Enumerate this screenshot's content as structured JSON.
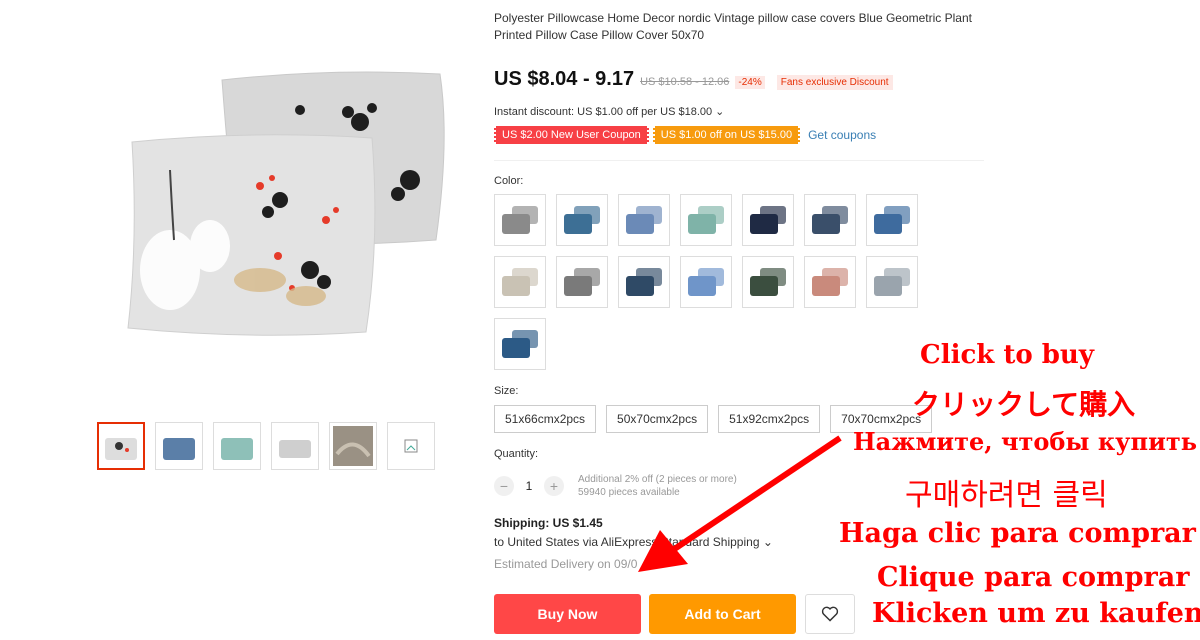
{
  "product": {
    "title": "Polyester Pillowcase Home Decor nordic Vintage pillow case covers Blue Geometric Plant Printed Pillow Case Pillow Cover 50x70",
    "price": "US $8.04 - 9.17",
    "original_price": "US $10.58 - 12.06",
    "discount_percent": "-24%",
    "fans_discount": "Fans exclusive Discount",
    "instant_discount": "Instant discount: US $1.00 off per US $18.00 ⌄",
    "coupons": [
      {
        "label": "US $2.00 New User Coupon",
        "color": "#f74045"
      },
      {
        "label": "US $1.00 off on US $15.00",
        "color": "#f79b0e"
      }
    ],
    "get_coupons": "Get coupons"
  },
  "color": {
    "label": "Color:",
    "swatches": [
      {
        "name": "color-1",
        "bg": "#ffffff",
        "fg": "#8a8a8a"
      },
      {
        "name": "color-2",
        "bg": "#ffffff",
        "fg": "#3d6f95"
      },
      {
        "name": "color-3",
        "bg": "#ffffff",
        "fg": "#6b8ab7"
      },
      {
        "name": "color-4",
        "bg": "#ffffff",
        "fg": "#7fb3a8"
      },
      {
        "name": "color-5",
        "bg": "#ffffff",
        "fg": "#1f2a44"
      },
      {
        "name": "color-6",
        "bg": "#ffffff",
        "fg": "#3a4f6a"
      },
      {
        "name": "color-7",
        "bg": "#ffffff",
        "fg": "#3e6b9e"
      },
      {
        "name": "color-8",
        "bg": "#ffffff",
        "fg": "#c9c2b4"
      },
      {
        "name": "color-9",
        "bg": "#ffffff",
        "fg": "#7a7a7a"
      },
      {
        "name": "color-10",
        "bg": "#ffffff",
        "fg": "#2f4a66"
      },
      {
        "name": "color-11",
        "bg": "#ffffff",
        "fg": "#6f95c9"
      },
      {
        "name": "color-12",
        "bg": "#ffffff",
        "fg": "#3b4e3f"
      },
      {
        "name": "color-13",
        "bg": "#ffffff",
        "fg": "#c98a7c"
      },
      {
        "name": "color-14",
        "bg": "#ffffff",
        "fg": "#9aa4ad"
      },
      {
        "name": "color-15",
        "bg": "#ffffff",
        "fg": "#2c5a86"
      }
    ]
  },
  "size": {
    "label": "Size:",
    "options": [
      "51x66cmx2pcs",
      "50x70cmx2pcs",
      "51x92cmx2pcs",
      "70x70cmx2pcs"
    ]
  },
  "quantity": {
    "label": "Quantity:",
    "value": "1",
    "minus": "−",
    "plus": "+",
    "info_line1": "Additional 2% off (2 pieces or more)",
    "info_line2": "59940 pieces available"
  },
  "shipping": {
    "title": "Shipping: US $1.45",
    "route": "to United States via AliExpress Standard Shipping ⌄",
    "estimated": "Estimated Delivery on 09/0"
  },
  "actions": {
    "buy_now": "Buy Now",
    "add_to_cart": "Add to Cart"
  },
  "promo": {
    "lines": [
      "Click to buy",
      "クリックして購入",
      "Нажмите, чтобы купить",
      "구매하려면 클릭",
      "Haga clic para comprar",
      "Clique para comprar",
      "Klicken um zu kaufen"
    ]
  },
  "colors": {
    "accent_red": "#ff4747",
    "accent_orange": "#ff9900",
    "promo_red": "#ff0000",
    "link_blue": "#3a7fb4"
  }
}
